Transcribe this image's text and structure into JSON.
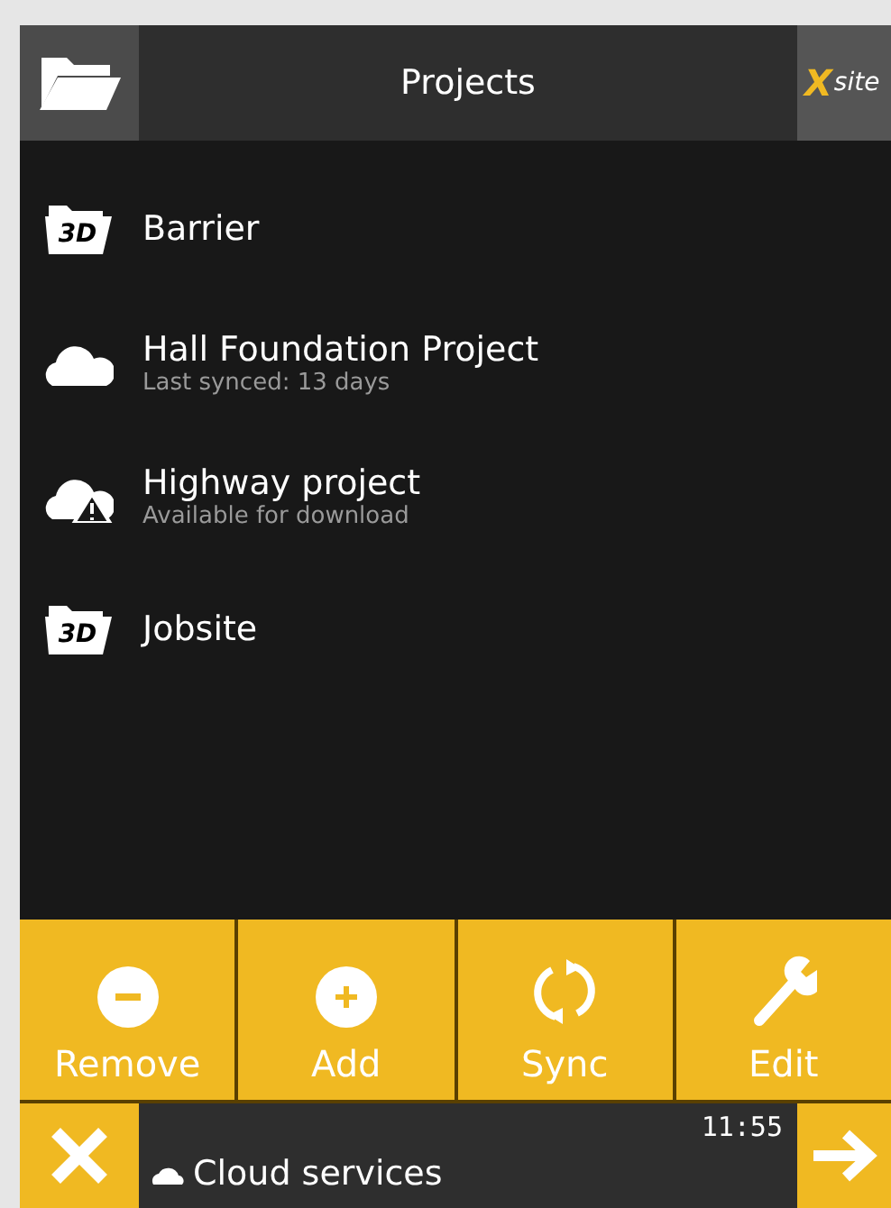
{
  "header": {
    "title": "Projects",
    "logo": {
      "mark": "X",
      "text": "site"
    }
  },
  "projects": [
    {
      "kind": "folder3d",
      "name": "Barrier",
      "icon_text": "3D"
    },
    {
      "kind": "cloud",
      "name": "Hall Foundation Project",
      "subtitle": "Last synced: 13 days"
    },
    {
      "kind": "cloud-warning",
      "name": "Highway project",
      "subtitle": "Available for download"
    },
    {
      "kind": "folder3d",
      "name": "Jobsite",
      "icon_text": "3D"
    }
  ],
  "toolbar": [
    {
      "kind": "remove",
      "label": "Remove"
    },
    {
      "kind": "add",
      "label": "Add"
    },
    {
      "kind": "sync",
      "label": "Sync"
    },
    {
      "kind": "edit",
      "label": "Edit"
    }
  ],
  "status": {
    "time": "11:55",
    "message": "Cloud services"
  }
}
